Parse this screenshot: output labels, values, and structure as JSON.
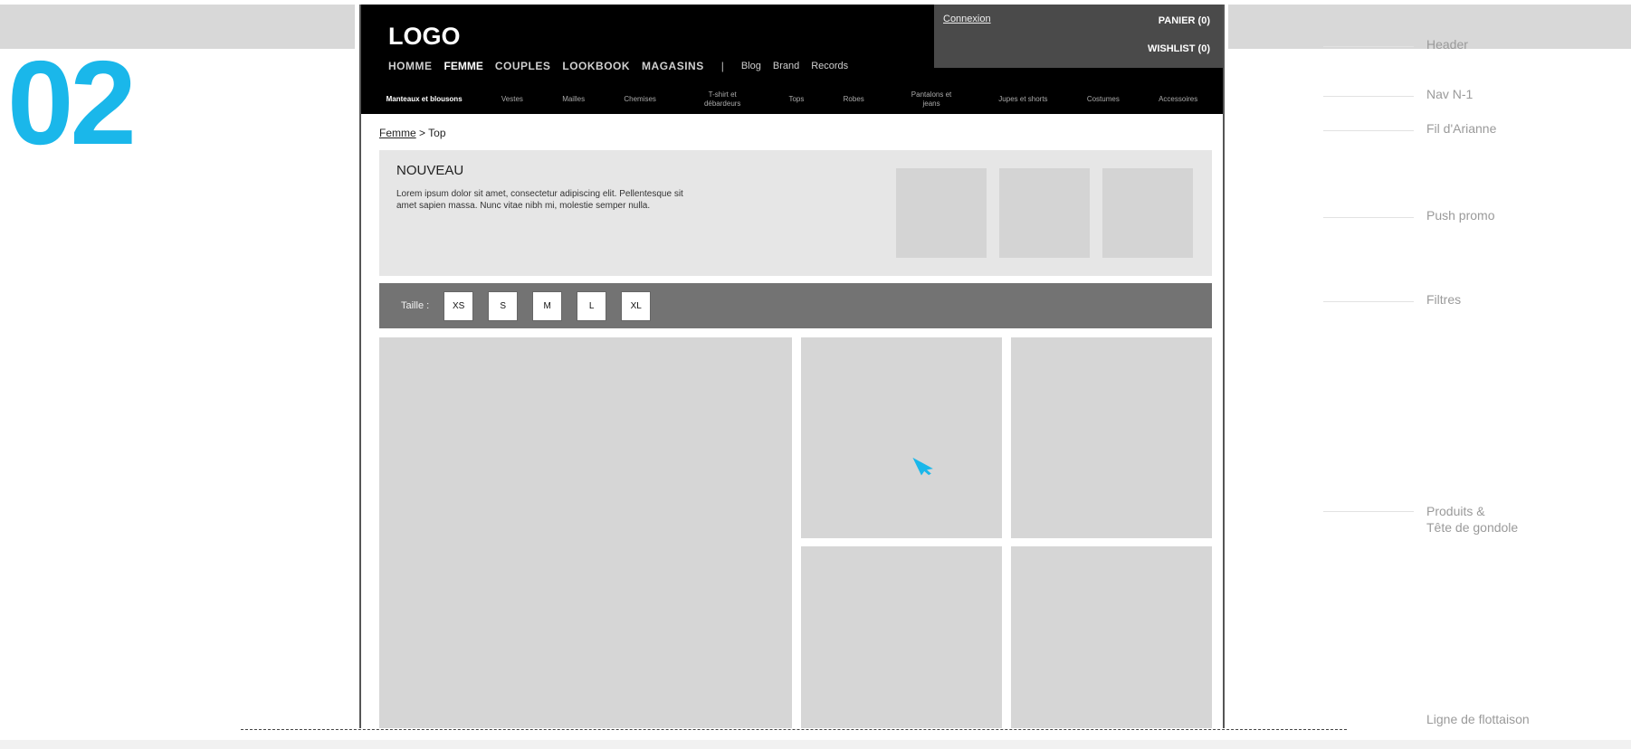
{
  "step_number": "02",
  "header": {
    "logo": "LOGO",
    "login": "Connexion",
    "cart": "PANIER (0)",
    "wishlist": "WISHLIST (0)",
    "main_nav": {
      "homme": "HOMME",
      "femme": "FEMME",
      "couples": "COUPLES",
      "lookbook": "LOOKBOOK",
      "magasins": "MAGASINS",
      "separator": "|",
      "blog": "Blog",
      "brand": "Brand",
      "records": "Records"
    }
  },
  "subnav": {
    "items": [
      {
        "label": "Manteaux et blousons"
      },
      {
        "label": "Vestes"
      },
      {
        "label": "Mailles"
      },
      {
        "label": "Chemises"
      },
      {
        "label": "T-shirt et débardeurs"
      },
      {
        "label": "Tops"
      },
      {
        "label": "Robes"
      },
      {
        "label": "Pantalons et jeans"
      },
      {
        "label": "Jupes et shorts"
      },
      {
        "label": "Costumes"
      },
      {
        "label": "Accessoires"
      }
    ]
  },
  "breadcrumb": {
    "parent": "Femme",
    "separator": ">",
    "current": "Top"
  },
  "promo": {
    "title": "NOUVEAU",
    "text": "Lorem ipsum dolor sit amet, consectetur adipiscing elit. Pellentesque sit amet sapien massa. Nunc vitae nibh mi, molestie semper nulla."
  },
  "filters": {
    "label": "Taille :",
    "sizes": [
      "XS",
      "S",
      "M",
      "L",
      "XL"
    ]
  },
  "annotations": {
    "header": "Header",
    "nav": "Nav N-1",
    "breadcrumb": "Fil d'Arianne",
    "promo": "Push promo",
    "filters": "Filtres",
    "products_line1": "Produits &",
    "products_line2": "Tête de gondole",
    "fold": "Ligne de flottaison"
  },
  "colors": {
    "accent": "#1ab7ea",
    "header_bg": "#000000",
    "account_bg": "#4a4a4a",
    "filter_bar": "#737373",
    "placeholder": "#d6d6d6"
  }
}
